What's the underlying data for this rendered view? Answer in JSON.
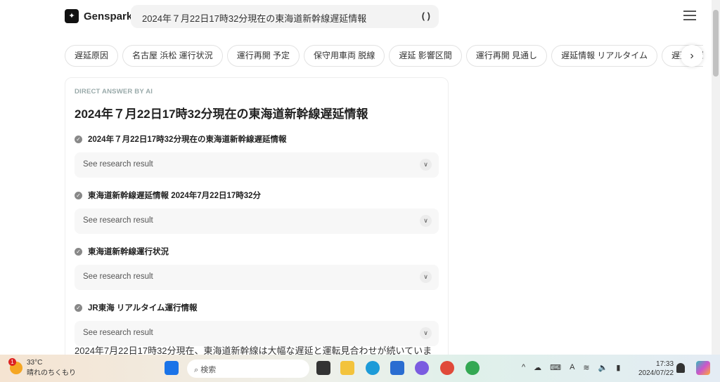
{
  "header": {
    "brand": "Genspark",
    "search_value": "2024年７月22日17時32分現在の東海道新幹線遅延情報"
  },
  "chips": [
    "遅延原因",
    "名古屋 浜松 運行状況",
    "運行再開 予定",
    "保守用車両 脱線",
    "遅延 影響区間",
    "運行再開 見通し",
    "遅延情報 リアルタイム",
    "遅延 影響"
  ],
  "card": {
    "label": "DIRECT ANSWER BY AI",
    "title": "2024年７月22日17時32分現在の東海道新幹線遅延情報",
    "sections": [
      {
        "heading": "2024年７月22日17時32分現在の東海道新幹線遅延情報",
        "accordion": "See research result"
      },
      {
        "heading": "東海道新幹線遅延情報 2024年7月22日17時32分",
        "accordion": "See research result"
      },
      {
        "heading": "東海道新幹線運行状況",
        "accordion": "See research result"
      },
      {
        "heading": "JR東海 リアルタイム運行情報",
        "accordion": "See research result"
      }
    ],
    "paragraph": "2024年7月22日17時32分現在、東海道新幹線は大幅な遅延と運転見合わせが続いていま"
  },
  "taskbar": {
    "temp": "33°C",
    "weather": "晴れのちくもり",
    "badge": "1",
    "search_placeholder": "検索",
    "time": "17:33",
    "date": "2024/07/22"
  }
}
